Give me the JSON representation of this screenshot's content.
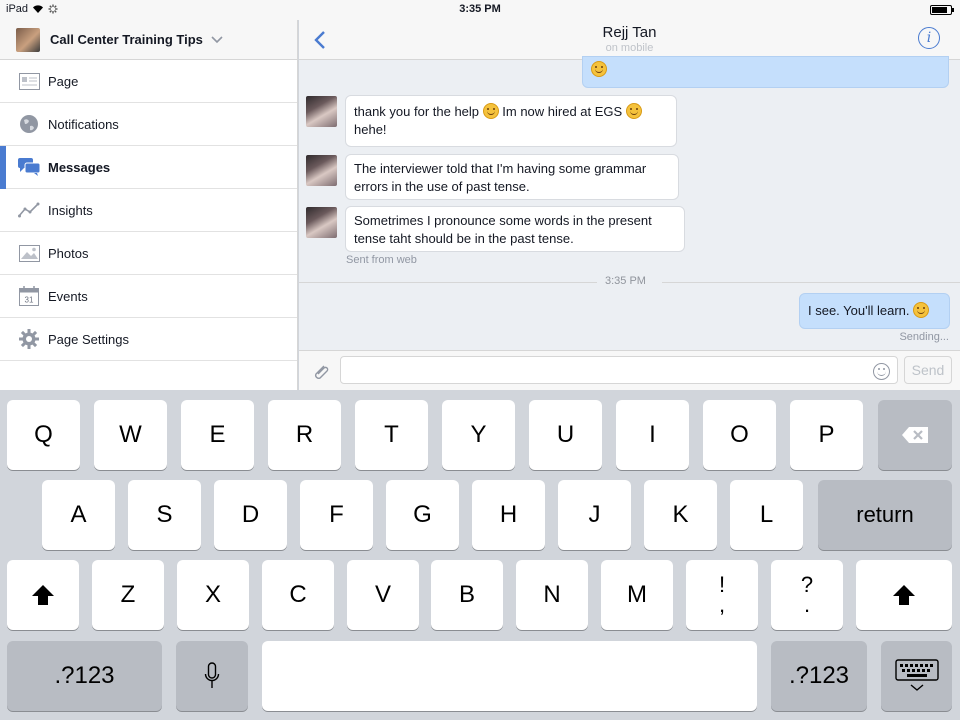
{
  "status_bar": {
    "device": "iPad",
    "time": "3:35 PM",
    "battery_percent": 85
  },
  "sidebar": {
    "page_name": "Call Center Training Tips",
    "items": [
      {
        "label": "Page",
        "icon": "page-icon",
        "active": false
      },
      {
        "label": "Notifications",
        "icon": "globe-icon",
        "active": false
      },
      {
        "label": "Messages",
        "icon": "messages-icon",
        "active": true
      },
      {
        "label": "Insights",
        "icon": "insights-icon",
        "active": false
      },
      {
        "label": "Photos",
        "icon": "photos-icon",
        "active": false
      },
      {
        "label": "Events",
        "icon": "calendar-icon",
        "active": false
      },
      {
        "label": "Page Settings",
        "icon": "gear-icon",
        "active": false
      }
    ],
    "events_icon_day": "31"
  },
  "chat": {
    "contact_name": "Rejj Tan",
    "contact_status": "on mobile",
    "messages": [
      {
        "direction": "incoming",
        "text_before": "thank you for the help ",
        "text_middle": " Im now hired at EGS ",
        "text_after": "hehe!"
      },
      {
        "direction": "incoming",
        "text": "The interviewer told that I'm having some grammar errors in the use of past tense."
      },
      {
        "direction": "incoming",
        "text": "Sometrimes I pronounce some words in the present tense taht should be in the past tense."
      },
      {
        "direction": "outgoing",
        "text": "I see. You'll learn. "
      }
    ],
    "sent_from": "Sent from web",
    "timestamp": "3:35 PM",
    "sending_status": "Sending...",
    "composer": {
      "placeholder": "",
      "send_label": "Send"
    }
  },
  "keyboard": {
    "row1": [
      "Q",
      "W",
      "E",
      "R",
      "T",
      "Y",
      "U",
      "I",
      "O",
      "P"
    ],
    "row2": [
      "A",
      "S",
      "D",
      "F",
      "G",
      "H",
      "J",
      "K",
      "L"
    ],
    "row3": [
      "Z",
      "X",
      "C",
      "V",
      "B",
      "N",
      "M"
    ],
    "exclaim_key": {
      "top": "!",
      "bottom": ","
    },
    "question_key": {
      "top": "?",
      "bottom": "."
    },
    "return_label": "return",
    "numbers_label": ".?123"
  },
  "colors": {
    "accent": "#4a7bd0",
    "outgoing_bubble": "#c5dffc",
    "keyboard_bg": "#d1d5db",
    "function_key": "#b8bcc3"
  }
}
